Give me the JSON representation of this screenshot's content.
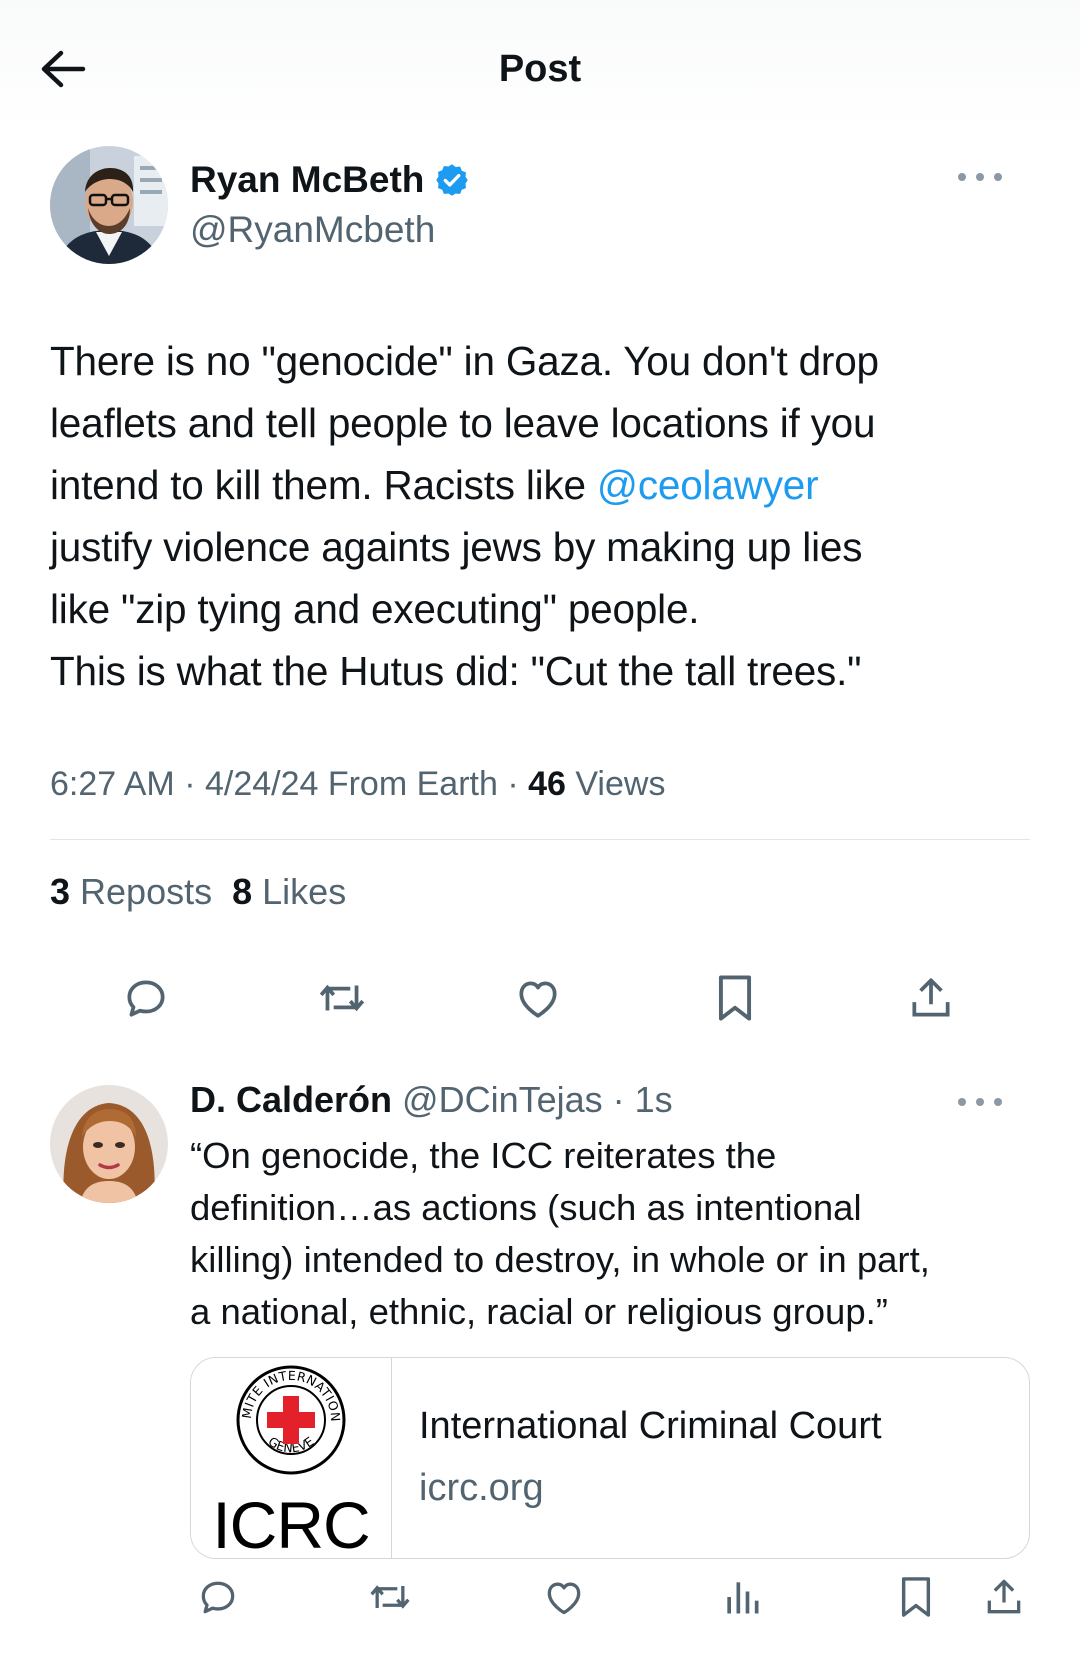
{
  "header": {
    "title": "Post",
    "back_icon": "arrow-left-icon"
  },
  "post": {
    "author": {
      "name": "Ryan McBeth",
      "handle": "@RyanMcbeth",
      "verified": true,
      "verified_color": "#1d9bf0"
    },
    "text": {
      "line1": "There is no \"genocide\" in Gaza. You don't drop",
      "line2": "leaflets and tell people to leave locations if you",
      "line3_pre": "intend to kill them. Racists like ",
      "line3_mention": "@ceolawyer",
      "line4": "justify violence againts jews by making up lies",
      "line5": "like \"zip tying and executing\" people.",
      "line6": "This is what the Hutus did: \"Cut the tall trees.\""
    },
    "meta": {
      "time_date": "6:27 AM · 4/24/24 From Earth · ",
      "views_count": "46",
      "views_label": " Views"
    },
    "stats": {
      "reposts_count": "3",
      "reposts_label": " Reposts",
      "likes_count": "8",
      "likes_label": " Likes"
    },
    "actions": [
      "reply-icon",
      "repost-icon",
      "like-icon",
      "bookmark-icon",
      "share-icon"
    ]
  },
  "reply": {
    "author": {
      "name": "D. Calderón",
      "handle": "@DCinTejas",
      "time": " · 1s"
    },
    "text": {
      "line1": "“On genocide, the ICC reiterates the",
      "line2": "definition…as actions (such as intentional",
      "line3": "killing) intended to destroy, in whole or in part,",
      "line4": "a national, ethnic, racial or religious group.”"
    },
    "card": {
      "logo_ring_text": "COMITE INTERNATIONAL GENEVE",
      "logo_text": "ICRC",
      "title": "International Criminal Court",
      "domain": "icrc.org"
    },
    "actions": [
      "reply-icon",
      "repost-icon",
      "like-icon",
      "analytics-icon",
      "bookmark-icon",
      "share-icon"
    ]
  },
  "colors": {
    "accent": "#1d9bf0",
    "text": "#0f1419",
    "secondary": "#536471",
    "border": "#cfd9de",
    "red_cross": "#e4202a"
  }
}
